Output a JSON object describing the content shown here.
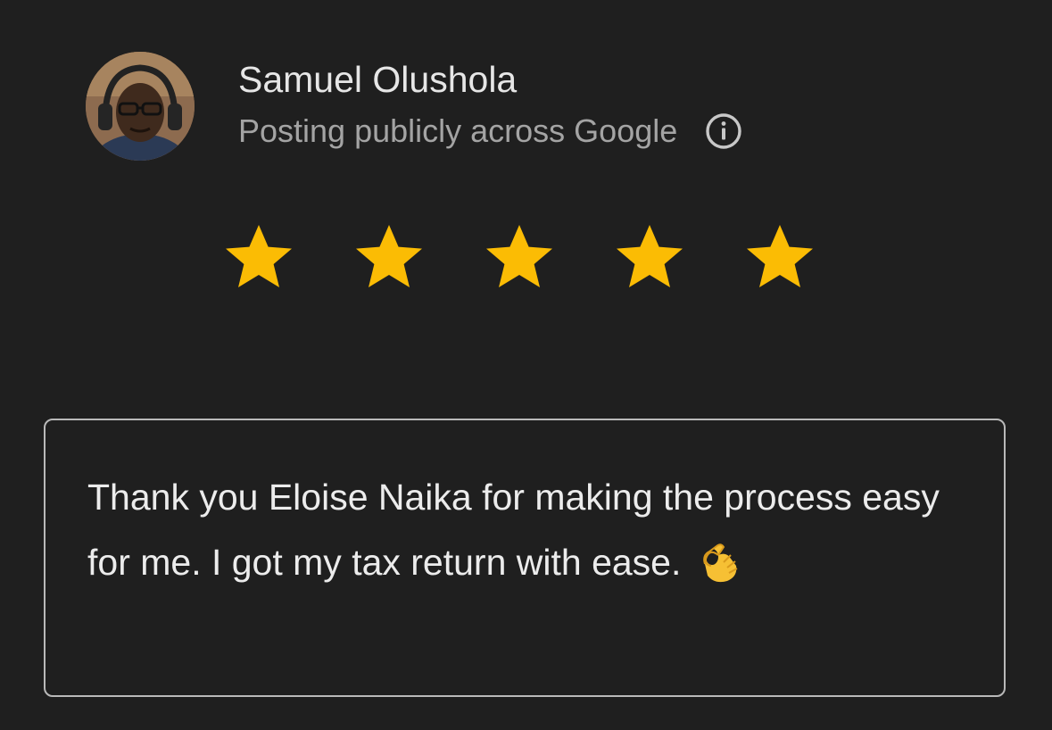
{
  "author": {
    "name": "Samuel Olushola",
    "posting_notice": "Posting publicly across Google",
    "avatar_icon": "user-photo-avatar",
    "info_icon": "info-icon"
  },
  "rating": {
    "value": 5,
    "max": 5,
    "star_color": "#fbbc04"
  },
  "review": {
    "text": "Thank you Eloise Naika for making the process easy for me. I got my tax return with ease.",
    "emoji": "ok-hand-emoji"
  },
  "colors": {
    "background": "#1f1f1f",
    "name_text": "#e6e6e6",
    "secondary_text": "#a4a4a4",
    "box_border": "#b9b9b9"
  }
}
